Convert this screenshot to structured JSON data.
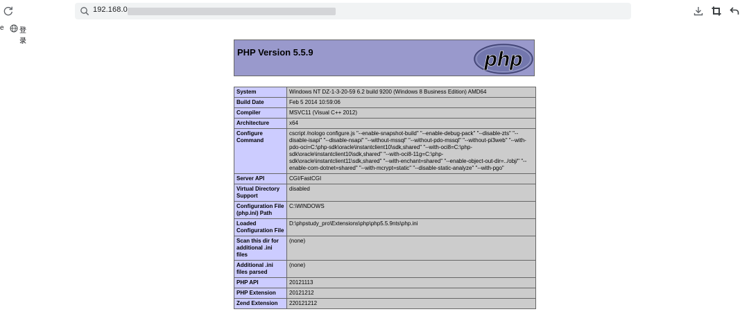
{
  "browser": {
    "url": "192.168.0.",
    "bookmarks": {
      "partial_item": "e",
      "login_label": "登录"
    }
  },
  "php_header": {
    "title": "PHP Version 5.5.9",
    "logo_text": "php"
  },
  "info_rows": [
    {
      "key": "System",
      "value": "Windows NT DZ-1-3-20-59 6.2 build 9200 (Windows 8 Business Edition) AMD64"
    },
    {
      "key": "Build Date",
      "value": "Feb 5 2014 10:59:06"
    },
    {
      "key": "Compiler",
      "value": "MSVC11 (Visual C++ 2012)"
    },
    {
      "key": "Architecture",
      "value": "x64"
    },
    {
      "key": "Configure Command",
      "value": "cscript /nologo configure.js \"--enable-snapshot-build\" \"--enable-debug-pack\" \"--disable-zts\" \"--disable-isapi\" \"--disable-nsapi\" \"--without-mssql\" \"--without-pdo-mssql\" \"--without-pi3web\" \"--with-pdo-oci=C:\\php-sdk\\oracle\\instantclient10\\sdk,shared\" \"--with-oci8=C:\\php-sdk\\oracle\\instantclient10\\sdk,shared\" \"--with-oci8-11g=C:\\php-sdk\\oracle\\instantclient11\\sdk,shared\" \"--with-enchant=shared\" \"--enable-object-out-dir=../obj/\" \"--enable-com-dotnet=shared\" \"--with-mcrypt=static\" \"--disable-static-analyze\" \"--with-pgo\""
    },
    {
      "key": "Server API",
      "value": "CGI/FastCGI"
    },
    {
      "key": "Virtual Directory Support",
      "value": "disabled"
    },
    {
      "key": "Configuration File (php.ini) Path",
      "value": "C:\\WINDOWS"
    },
    {
      "key": "Loaded Configuration File",
      "value": "D:\\phpstudy_pro\\Extensions\\php\\php5.5.9nts\\php.ini"
    },
    {
      "key": "Scan this dir for additional .ini files",
      "value": "(none)"
    },
    {
      "key": "Additional .ini files parsed",
      "value": "(none)"
    },
    {
      "key": "PHP API",
      "value": "20121113"
    },
    {
      "key": "PHP Extension",
      "value": "20121212"
    },
    {
      "key": "Zend Extension",
      "value": "220121212"
    }
  ]
}
